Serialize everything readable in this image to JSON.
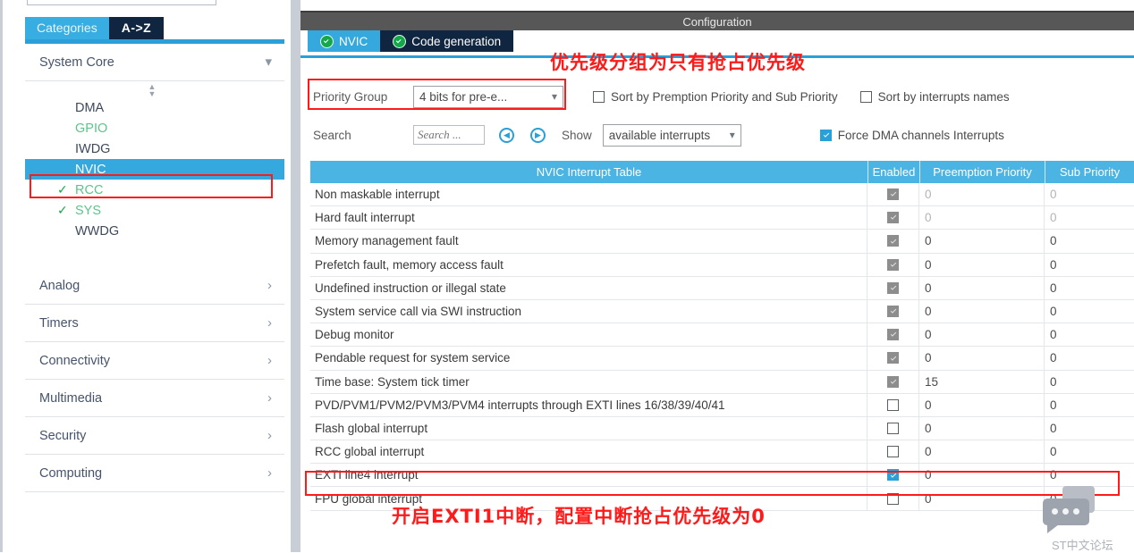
{
  "sidebar": {
    "tabs": [
      {
        "label": "Categories",
        "active": true
      },
      {
        "label": "A->Z",
        "active": false
      }
    ],
    "groups": [
      {
        "label": "System Core",
        "expanded": true,
        "icon": "chevron-down-icon"
      },
      {
        "label": "Analog",
        "expanded": false,
        "icon": "chevron-right-icon"
      },
      {
        "label": "Timers",
        "expanded": false,
        "icon": "chevron-right-icon"
      },
      {
        "label": "Connectivity",
        "expanded": false,
        "icon": "chevron-right-icon"
      },
      {
        "label": "Multimedia",
        "expanded": false,
        "icon": "chevron-right-icon"
      },
      {
        "label": "Security",
        "expanded": false,
        "icon": "chevron-right-icon"
      },
      {
        "label": "Computing",
        "expanded": false,
        "icon": "chevron-right-icon"
      }
    ],
    "system_core_items": [
      {
        "label": "DMA",
        "state": "plain",
        "checked": false,
        "selected": false
      },
      {
        "label": "GPIO",
        "state": "green",
        "checked": false,
        "selected": false
      },
      {
        "label": "IWDG",
        "state": "plain",
        "checked": false,
        "selected": false
      },
      {
        "label": "NVIC",
        "state": "plain",
        "checked": false,
        "selected": true
      },
      {
        "label": "RCC",
        "state": "green",
        "checked": true,
        "selected": false
      },
      {
        "label": "SYS",
        "state": "green",
        "checked": true,
        "selected": false
      },
      {
        "label": "WWDG",
        "state": "plain",
        "checked": false,
        "selected": false
      }
    ]
  },
  "configuration": {
    "title": "Configuration",
    "tabs": [
      {
        "label": "NVIC",
        "active": true
      },
      {
        "label": "Code generation",
        "active": false
      }
    ],
    "priority_group": {
      "label": "Priority Group",
      "value": "4 bits for pre-e...",
      "caret": "⌄"
    },
    "sort_by_preemption": {
      "label": "Sort by Premption Priority and Sub Priority",
      "checked": false
    },
    "sort_by_names": {
      "label": "Sort by interrupts names",
      "checked": false
    },
    "search": {
      "label": "Search",
      "placeholder": "Search ...",
      "value": "",
      "prev_icon": "chevron-left-circle-icon",
      "next_icon": "chevron-right-circle-icon",
      "prev_glyph": "◀",
      "next_glyph": "▶"
    },
    "show": {
      "label": "Show",
      "value": "available interrupts",
      "caret": "⌄"
    },
    "force_dma": {
      "label": "Force DMA channels Interrupts",
      "checked": true
    },
    "table": {
      "headers": [
        "NVIC Interrupt Table",
        "Enabled",
        "Preemption Priority",
        "Sub Priority"
      ],
      "rows": [
        {
          "name": "Non maskable interrupt",
          "enabled": true,
          "locked": true,
          "preemption": "0",
          "sub": "0",
          "dim": true,
          "highlight": false
        },
        {
          "name": "Hard fault interrupt",
          "enabled": true,
          "locked": true,
          "preemption": "0",
          "sub": "0",
          "dim": true,
          "highlight": false
        },
        {
          "name": "Memory management fault",
          "enabled": true,
          "locked": true,
          "preemption": "0",
          "sub": "0",
          "dim": false,
          "highlight": false
        },
        {
          "name": "Prefetch fault, memory access fault",
          "enabled": true,
          "locked": true,
          "preemption": "0",
          "sub": "0",
          "dim": false,
          "highlight": false
        },
        {
          "name": "Undefined instruction or illegal state",
          "enabled": true,
          "locked": true,
          "preemption": "0",
          "sub": "0",
          "dim": false,
          "highlight": false
        },
        {
          "name": "System service call via SWI instruction",
          "enabled": true,
          "locked": true,
          "preemption": "0",
          "sub": "0",
          "dim": false,
          "highlight": false
        },
        {
          "name": "Debug monitor",
          "enabled": true,
          "locked": true,
          "preemption": "0",
          "sub": "0",
          "dim": false,
          "highlight": false
        },
        {
          "name": "Pendable request for system service",
          "enabled": true,
          "locked": true,
          "preemption": "0",
          "sub": "0",
          "dim": false,
          "highlight": false
        },
        {
          "name": "Time base: System tick timer",
          "enabled": true,
          "locked": true,
          "preemption": "15",
          "sub": "0",
          "dim": false,
          "highlight": false
        },
        {
          "name": "PVD/PVM1/PVM2/PVM3/PVM4 interrupts through EXTI lines 16/38/39/40/41",
          "enabled": false,
          "locked": false,
          "preemption": "0",
          "sub": "0",
          "dim": false,
          "highlight": false
        },
        {
          "name": "Flash global interrupt",
          "enabled": false,
          "locked": false,
          "preemption": "0",
          "sub": "0",
          "dim": false,
          "highlight": false
        },
        {
          "name": "RCC global interrupt",
          "enabled": false,
          "locked": false,
          "preemption": "0",
          "sub": "0",
          "dim": false,
          "highlight": false
        },
        {
          "name": "EXTI line4 interrupt",
          "enabled": true,
          "locked": false,
          "preemption": "0",
          "sub": "0",
          "dim": false,
          "highlight": true
        },
        {
          "name": "FPU global interrupt",
          "enabled": false,
          "locked": false,
          "preemption": "0",
          "sub": "0",
          "dim": false,
          "highlight": false
        }
      ]
    }
  },
  "annotations": {
    "top": "优先级分组为只有抢占优先级",
    "bottom": "开启EXTI1中断，配置中断抢占优先级为0",
    "color": "#ff1a1a"
  },
  "watermark": {
    "text": "ST中文论坛",
    "icon": "speech-bubble-icon"
  },
  "colors": {
    "accent_blue": "#35a8dd",
    "table_header_blue": "#4bb4e3",
    "dark_navy": "#10253f",
    "green_check": "#17a74a",
    "annotation_red": "#ff1a1a",
    "title_gray": "#575757"
  }
}
